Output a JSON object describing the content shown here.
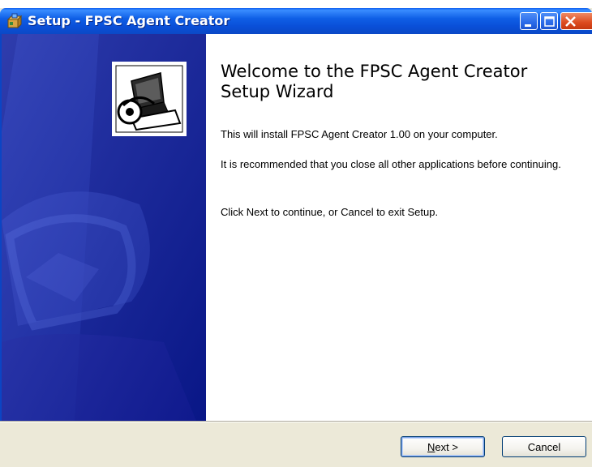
{
  "window": {
    "title": "Setup - FPSC Agent Creator",
    "controls": [
      "minimize",
      "maximize",
      "close"
    ]
  },
  "wizard": {
    "heading": "Welcome to the FPSC Agent Creator Setup Wizard",
    "paragraphs": [
      "This will install FPSC Agent Creator 1.00 on your computer.",
      "It is recommended that you close all other applications before continuing.",
      "Click Next to continue, or Cancel to exit Setup."
    ]
  },
  "buttons": {
    "next_mnemonic": "N",
    "next_rest": "ext >",
    "cancel": "Cancel"
  },
  "icons": {
    "app": "setup-box-icon",
    "wizard": "computer-install-icon"
  },
  "colors": {
    "titlebar": "#0a4fd8",
    "banner": "#0a1a9e",
    "close": "#dc4a1e",
    "dialog": "#ece9d8"
  }
}
